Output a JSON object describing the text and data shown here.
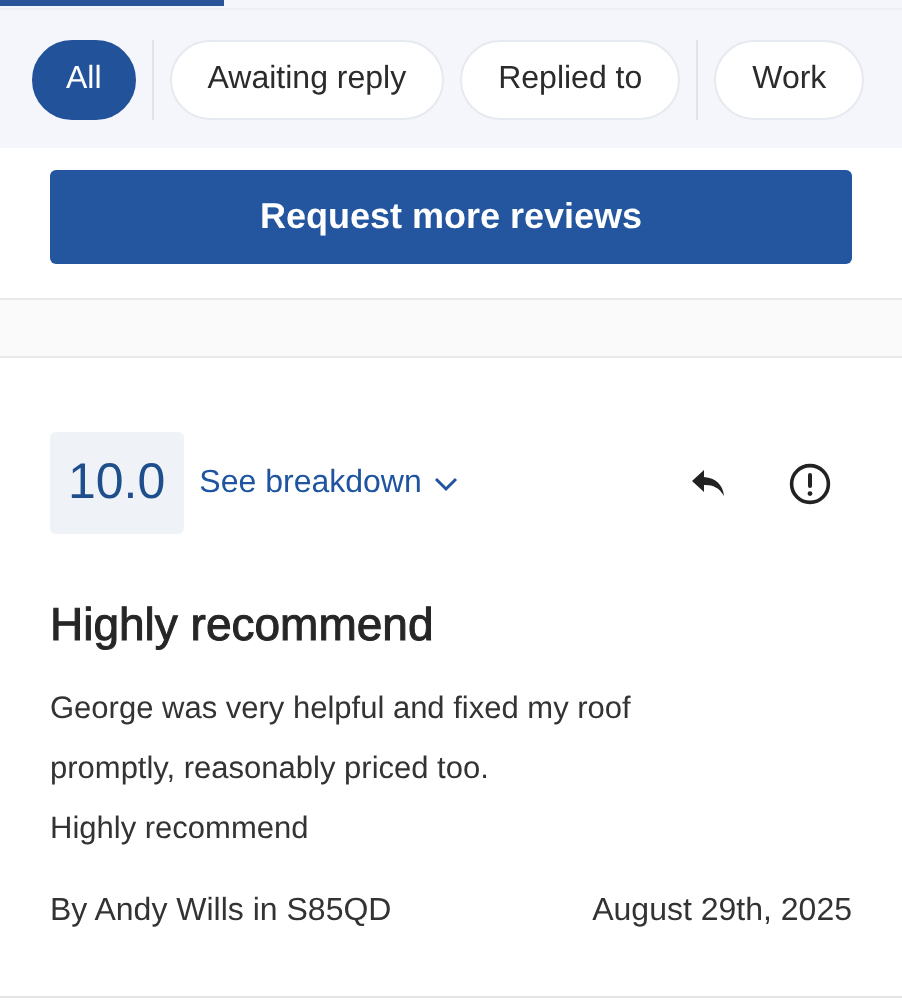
{
  "filters": [
    {
      "label": "All",
      "selected": true,
      "divider_after": true
    },
    {
      "label": "Awaiting reply",
      "selected": false,
      "divider_after": false
    },
    {
      "label": "Replied to",
      "selected": false,
      "divider_after": true
    },
    {
      "label": "Work",
      "selected": false,
      "divider_after": false
    }
  ],
  "request_button": "Request more reviews",
  "review": {
    "score": "10.0",
    "breakdown_link": "See breakdown",
    "title": "Highly recommend",
    "body": "George was very helpful and fixed my roof promptly, reasonably priced too.\nHighly recommend",
    "author": "By Andy Wills in S85QD",
    "date": "August 29th, 2025"
  }
}
